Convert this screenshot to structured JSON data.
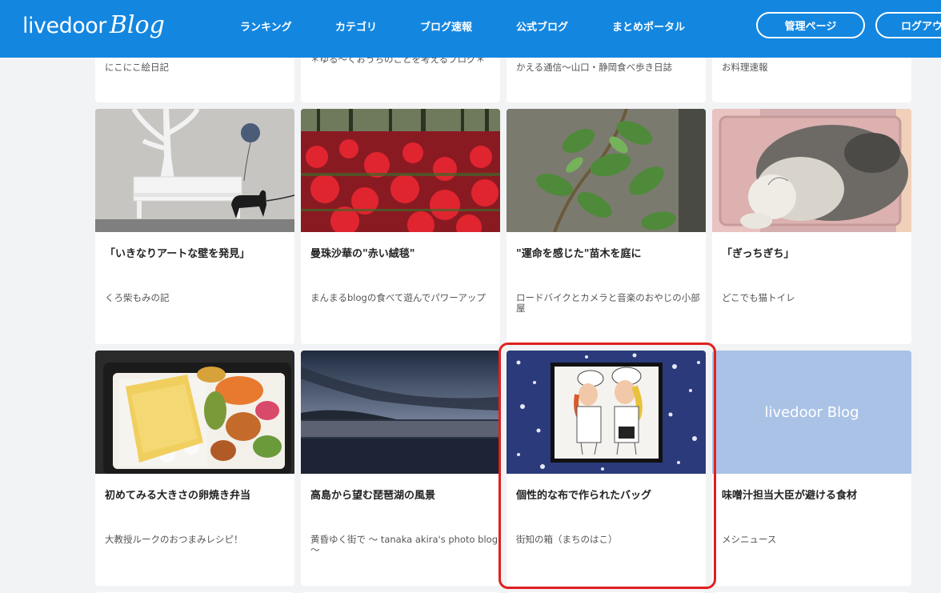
{
  "header": {
    "logo_main": "livedoor",
    "logo_sub": "Blog",
    "nav": [
      "ランキング",
      "カテゴリ",
      "ブログ速報",
      "公式ブログ",
      "まとめポータル"
    ],
    "manage_button": "管理ページ",
    "logout_button": "ログアウ"
  },
  "top_row": [
    {
      "blog": "にこにこ絵日記"
    },
    {
      "blog": "＊ゆる〜くおうちのことを考えるブログ＊"
    },
    {
      "blog": "かえる通信〜山口・静岡食べ歩き日誌"
    },
    {
      "blog": "お料理速報"
    }
  ],
  "row1": [
    {
      "title": "「いきなりアートな壁を発見」",
      "blog": "くろ柴もみの記"
    },
    {
      "title": "曼珠沙華の\"赤い絨毯\"",
      "blog": "まんまるblogの食べて遊んでパワーアップ"
    },
    {
      "title": "\"運命を感じた\"苗木を庭に",
      "blog": "ロードバイクとカメラと音楽のおやじの小部屋"
    },
    {
      "title": "「ぎっちぎち」",
      "blog": "どこでも猫トイレ"
    }
  ],
  "row2": [
    {
      "title": "初めてみる大きさの卵焼き弁当",
      "blog": "大教授ルークのおつまみレシピ！"
    },
    {
      "title": "高島から望む琵琶湖の風景",
      "blog": "黄昏ゆく街で 〜 tanaka akira's photo blog 〜"
    },
    {
      "title": "個性的な布で作られたバッグ",
      "blog": "街知の箱（まちのはこ）"
    },
    {
      "title": "味噌汁担当大臣が避ける食材",
      "blog": "メシニュース"
    }
  ],
  "placeholder_logo": "livedoor Blog",
  "colors": {
    "header": "#1386e0",
    "highlight": "#e02020"
  }
}
